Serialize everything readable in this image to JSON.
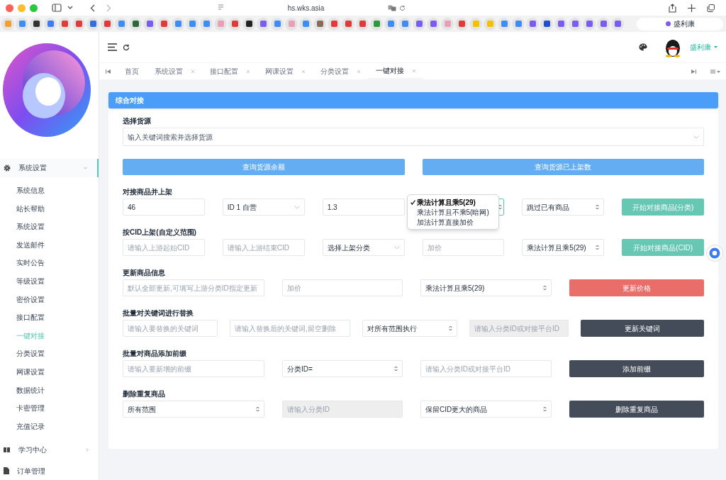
{
  "browser": {
    "address": "hs.wks.asia",
    "tab_title": "盛利康"
  },
  "sidebar": {
    "items": [
      {
        "label": "系统设置",
        "expanded": true,
        "children": [
          {
            "label": "系统信息",
            "selected": false
          },
          {
            "label": "站长帮助",
            "selected": false
          },
          {
            "label": "系统设置",
            "selected": false
          },
          {
            "label": "发送邮件",
            "selected": false
          },
          {
            "label": "实时公告",
            "selected": false
          },
          {
            "label": "等级设置",
            "selected": false
          },
          {
            "label": "密价设置",
            "selected": false
          },
          {
            "label": "接口配置",
            "selected": false
          },
          {
            "label": "一键对接",
            "selected": true
          },
          {
            "label": "分类设置",
            "selected": false
          },
          {
            "label": "网课设置",
            "selected": false
          },
          {
            "label": "数据统计",
            "selected": false
          },
          {
            "label": "卡密管理",
            "selected": false
          },
          {
            "label": "充值记录",
            "selected": false
          }
        ]
      },
      {
        "label": "学习中心",
        "expanded": false
      },
      {
        "label": "订单管理"
      }
    ]
  },
  "header": {
    "user": "盛利康"
  },
  "tabs": [
    {
      "label": "首页",
      "closable": false,
      "selected": false
    },
    {
      "label": "系统设置",
      "closable": true,
      "selected": false
    },
    {
      "label": "接口配置",
      "closable": true,
      "selected": false
    },
    {
      "label": "网课设置",
      "closable": true,
      "selected": false
    },
    {
      "label": "分类设置",
      "closable": true,
      "selected": false
    },
    {
      "label": "一键对接",
      "closable": true,
      "selected": true
    }
  ],
  "card": {
    "title": "综合对接",
    "sections": [
      {
        "label": "选择货源",
        "controls": [
          {
            "kind": "combo",
            "placeholder": "输入关键词搜索并选择货源"
          }
        ]
      },
      {
        "controls": [
          {
            "kind": "button",
            "label": "查询货源余额"
          },
          {
            "kind": "button",
            "label": "查询货源已上架数"
          }
        ]
      },
      {
        "label": "对接商品并上架",
        "controls": [
          {
            "kind": "input",
            "value": "46"
          },
          {
            "kind": "combo",
            "value": "ID 1 自营"
          },
          {
            "kind": "input",
            "value": "1.3"
          },
          {
            "kind": "select",
            "open": true,
            "options": [
              {
                "label": "乘法计算且乘5(29)",
                "selected": true
              },
              {
                "label": "乘法计算且不乘5(暗网)",
                "selected": false
              },
              {
                "label": "加法计算直接加价",
                "selected": false
              }
            ]
          },
          {
            "kind": "select",
            "value": "跳过已有商品"
          },
          {
            "kind": "button",
            "label": "开始对接商品(分类)"
          }
        ]
      },
      {
        "label": "按CID上架(自定义范围)",
        "controls": [
          {
            "kind": "input",
            "placeholder": "请输入上游起始CID"
          },
          {
            "kind": "input",
            "placeholder": "请输入上游结束CID"
          },
          {
            "kind": "combo",
            "value": "选择上架分类"
          },
          {
            "kind": "input",
            "placeholder": "加价"
          },
          {
            "kind": "select",
            "value": "乘法计算且乘5(29)"
          },
          {
            "kind": "button",
            "label": "开始对接商品(CID)"
          }
        ]
      },
      {
        "label": "更新商品信息",
        "controls": [
          {
            "kind": "input",
            "placeholder": "默认全部更新,可填写上游分类ID指定更新"
          },
          {
            "kind": "input",
            "placeholder": "加价"
          },
          {
            "kind": "select",
            "value": "乘法计算且乘5(29)"
          },
          {
            "kind": "button",
            "label": "更新价格"
          }
        ]
      },
      {
        "label": "批量对关键词进行替换",
        "controls": [
          {
            "kind": "input",
            "placeholder": "请输入要替换的关键词"
          },
          {
            "kind": "input",
            "placeholder": "请输入替换后的关键词,留空删除"
          },
          {
            "kind": "select",
            "value": "对所有范围执行"
          },
          {
            "kind": "input",
            "placeholder": "请输入分类ID或对接平台ID",
            "disabled": true
          },
          {
            "kind": "button",
            "label": "更新关键词"
          }
        ]
      },
      {
        "label": "批量对商品添加前缀",
        "controls": [
          {
            "kind": "input",
            "placeholder": "请输入要新增的前缀"
          },
          {
            "kind": "select",
            "value": "分类ID="
          },
          {
            "kind": "input",
            "placeholder": "请输入分类ID或对接平台ID"
          },
          {
            "kind": "button",
            "label": "添加前缀"
          }
        ]
      },
      {
        "label": "删除重复商品",
        "controls": [
          {
            "kind": "select",
            "value": "所有范围"
          },
          {
            "kind": "input",
            "placeholder": "请输入分类ID",
            "disabled": true
          },
          {
            "kind": "select",
            "value": "保留CID更大的商品"
          },
          {
            "kind": "button",
            "label": "删除重复商品"
          }
        ]
      }
    ]
  }
}
